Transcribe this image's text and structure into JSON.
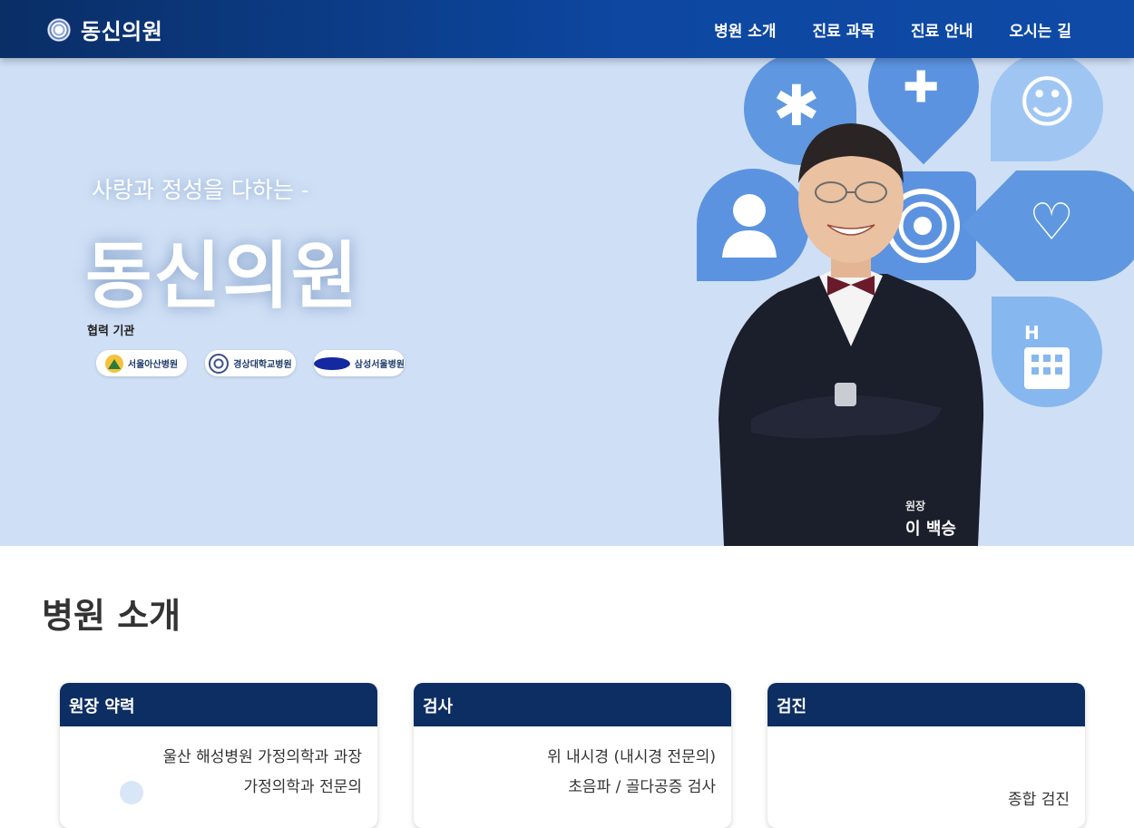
{
  "header": {
    "brand": "동신의원",
    "nav": [
      "병원 소개",
      "진료 과목",
      "진료 안내",
      "오시는 길"
    ]
  },
  "hero": {
    "tagline": "사랑과 정성을 다하는 -",
    "title": "동신의원",
    "partners_label": "협력 기관",
    "partners": [
      "서울아산병원",
      "경상대학교병원",
      "삼성서울병원"
    ],
    "director_role": "원장",
    "director_name": "이 백승"
  },
  "intro": {
    "title": "병원 소개",
    "cards": [
      {
        "title": "원장 약력",
        "lines": [
          "울산 해성병원 가정의학과 과장",
          "가정의학과 전문의"
        ]
      },
      {
        "title": "검사",
        "lines": [
          "위 내시경 (내시경 전문의)",
          "초음파 / 골다공증 검사"
        ]
      },
      {
        "title": "검진",
        "lines": [
          "종합 검진"
        ]
      }
    ]
  },
  "colors": {
    "header": "#0d47a1",
    "hero_bg": "#cfdff5",
    "card_header": "#0d2e62",
    "icon_blue": "#5b93e0"
  }
}
